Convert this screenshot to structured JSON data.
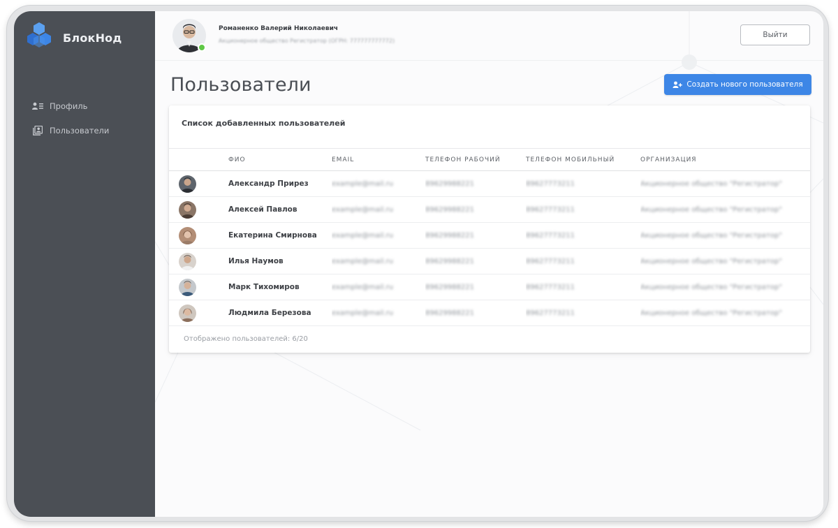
{
  "brand": {
    "name": "БлокНод",
    "colors": [
      "#3d86e6",
      "#5ba0ef",
      "#2f6fcf"
    ]
  },
  "sidebar": {
    "items": [
      {
        "label": "Профиль",
        "icon": "profile-icon"
      },
      {
        "label": "Пользователи",
        "icon": "users-icon"
      }
    ]
  },
  "header": {
    "user_name": "Романенко Валерий Николаевич",
    "user_org": "Акционерное общество Регистратор (ОГРН: 777777777772)",
    "online_color": "#5fc846",
    "logout_label": "Выйти"
  },
  "page": {
    "title": "Пользователи",
    "create_button_label": "Создать нового пользователя",
    "accent": "#3d86e6"
  },
  "users_table": {
    "title": "Список добавленных пользователей",
    "columns": [
      "",
      "ФИО",
      "EMAIL",
      "ТЕЛЕФОН РАБОЧИЙ",
      "ТЕЛЕФОН МОБИЛЬНЫЙ",
      "ОРГАНИЗАЦИЯ"
    ],
    "rows": [
      {
        "name": "Александр Прирез",
        "email": "example@mail.ru",
        "work_phone": "89629988221",
        "mobile_phone": "89627773211",
        "org": "Акционерное общество \"Регистратор\""
      },
      {
        "name": "Алексей Павлов",
        "email": "example@mail.ru",
        "work_phone": "89629988221",
        "mobile_phone": "89627773211",
        "org": "Акционерное общество \"Регистратор\""
      },
      {
        "name": "Екатерина Смирнова",
        "email": "example@mail.ru",
        "work_phone": "89629988221",
        "mobile_phone": "89627773211",
        "org": "Акционерное общество \"Регистратор\""
      },
      {
        "name": "Илья Наумов",
        "email": "example@mail.ru",
        "work_phone": "89629988221",
        "mobile_phone": "89627773211",
        "org": "Акционерное общество \"Регистратор\""
      },
      {
        "name": "Марк Тихомиров",
        "email": "example@mail.ru",
        "work_phone": "89629988221",
        "mobile_phone": "89627773211",
        "org": "Акционерное общество \"Регистратор\""
      },
      {
        "name": "Людмила Березова",
        "email": "example@mail.ru",
        "work_phone": "89629988221",
        "mobile_phone": "89627773211",
        "org": "Акционерное общество \"Регистратор\""
      }
    ],
    "count_label": "Отображено пользователей: 6/20"
  }
}
